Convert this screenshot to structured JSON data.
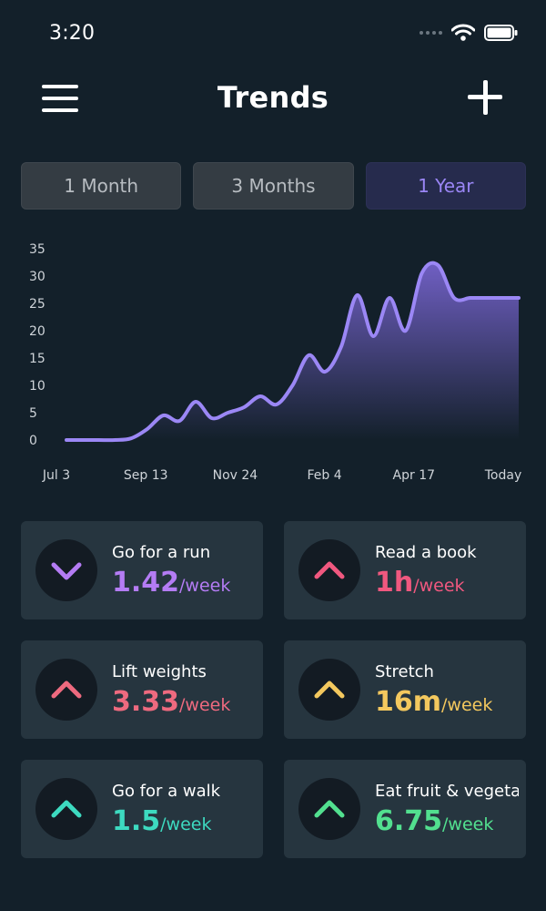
{
  "status_bar": {
    "time": "3:20"
  },
  "header": {
    "title": "Trends"
  },
  "tabs": [
    {
      "label": "1 Month",
      "active": false
    },
    {
      "label": "3 Months",
      "active": false
    },
    {
      "label": "1 Year",
      "active": true
    }
  ],
  "chart_data": {
    "type": "area",
    "title": "",
    "xlabel": "",
    "ylabel": "",
    "ylim": [
      0,
      35
    ],
    "yticks": [
      35,
      30,
      25,
      20,
      15,
      10,
      5,
      0
    ],
    "x_tick_labels": [
      "Jul 3",
      "Sep 13",
      "Nov 24",
      "Feb 4",
      "Apr 17",
      "Today"
    ],
    "grid": false,
    "series": [
      {
        "color": "#9b87f5",
        "x": [
          "Jul 3",
          "Jul 20",
          "Aug 10",
          "Aug 30",
          "Sep 13",
          "Sep 20",
          "Oct 5",
          "Oct 20",
          "Nov 5",
          "Nov 24",
          "Dec 1",
          "Dec 15",
          "Dec 30",
          "Jan 10",
          "Jan 25",
          "Feb 4",
          "Feb 15",
          "Mar 1",
          "Mar 10",
          "Mar 25",
          "Apr 5",
          "Apr 17",
          "Apr 28",
          "May 10",
          "May 20",
          "Jun 1",
          "Jun 12",
          "Jun 20",
          "Today"
        ],
        "values": [
          0,
          0,
          0,
          0,
          0.3,
          2,
          4.5,
          3.5,
          7,
          4,
          5,
          6,
          8,
          6.5,
          10,
          15.5,
          12.5,
          17,
          26.5,
          19,
          26,
          20,
          30.5,
          32,
          26,
          26,
          26,
          26,
          26
        ]
      }
    ]
  },
  "habits": [
    {
      "title": "Go for a run",
      "value": "1.42",
      "unit": "/week",
      "trend": "down",
      "color": "#b47cf4"
    },
    {
      "title": "Read a book",
      "value": "1h",
      "unit": "/week",
      "trend": "up",
      "color": "#f0587f"
    },
    {
      "title": "Lift weights",
      "value": "3.33",
      "unit": "/week",
      "trend": "up",
      "color": "#ee6a7f"
    },
    {
      "title": "Stretch",
      "value": "16m",
      "unit": "/week",
      "trend": "up",
      "color": "#f3c85e"
    },
    {
      "title": "Go for a walk",
      "value": "1.5",
      "unit": "/week",
      "trend": "up",
      "color": "#3ddac0"
    },
    {
      "title": "Eat fruit & vegetables",
      "value": "6.75",
      "unit": "/week",
      "trend": "up",
      "color": "#52e08f"
    }
  ]
}
